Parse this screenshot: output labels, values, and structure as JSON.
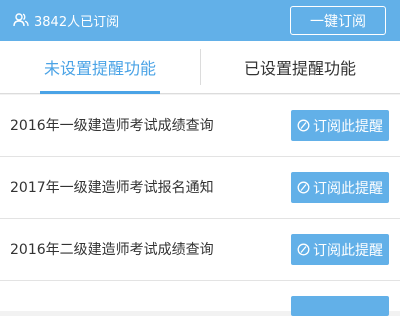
{
  "header": {
    "subscriber_text": "3842人已订阅",
    "icon": "users-icon",
    "subscribe_all_label": "一键订阅",
    "bg_color": "#62b0e8"
  },
  "tabs": [
    {
      "label": "未设置提醒功能",
      "active": true
    },
    {
      "label": "已设置提醒功能",
      "active": false
    }
  ],
  "list": {
    "button_icon": "no-alarm-icon",
    "items": [
      {
        "title": "2016年一级建造师考试成绩查询",
        "button_label": "订阅此提醒"
      },
      {
        "title": "2017年一级建造师考试报名通知",
        "button_label": "订阅此提醒"
      },
      {
        "title": "2016年二级建造师考试成绩查询",
        "button_label": "订阅此提醒"
      }
    ]
  }
}
